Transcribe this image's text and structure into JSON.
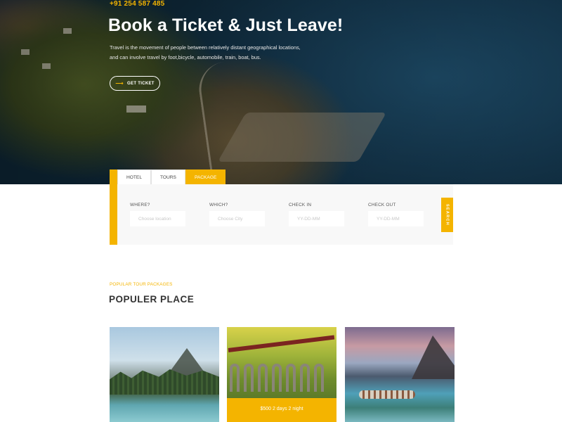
{
  "hero": {
    "phone": "+91 254 587 485",
    "title": "Book a Ticket & Just Leave!",
    "description": "Travel is the movement of people between relatively distant geographical locations, and can involve travel by foot,bicycle, automobile, train, boat, bus.",
    "cta_label": "GET TICKET",
    "cta_icon": "arrow-right-icon"
  },
  "tabs": [
    {
      "label": "HOTEL",
      "active": false
    },
    {
      "label": "TOURS",
      "active": false
    },
    {
      "label": "PACKAGE",
      "active": true
    }
  ],
  "search": {
    "fields": [
      {
        "label": "WHERE?",
        "placeholder": "Choose location"
      },
      {
        "label": "WHICH?",
        "placeholder": "Choose City"
      },
      {
        "label": "CHECK IN",
        "placeholder": "YY-DD-MM"
      },
      {
        "label": "CHECK OUT",
        "placeholder": "YY-DD-MM"
      }
    ],
    "button_label": "SEARCH"
  },
  "popular": {
    "kicker": "POPULAR TOUR PACKAGES",
    "title": "POPULER PLACE",
    "cards": [
      {
        "image": "mountain-lake-photo",
        "caption": ""
      },
      {
        "image": "train-viaduct-photo",
        "caption": "$500 2 days 2 night"
      },
      {
        "image": "fjord-village-photo",
        "caption": ""
      }
    ]
  },
  "colors": {
    "accent": "#f4b400",
    "heading": "#333333",
    "panel_bg": "#f8f8f8"
  }
}
